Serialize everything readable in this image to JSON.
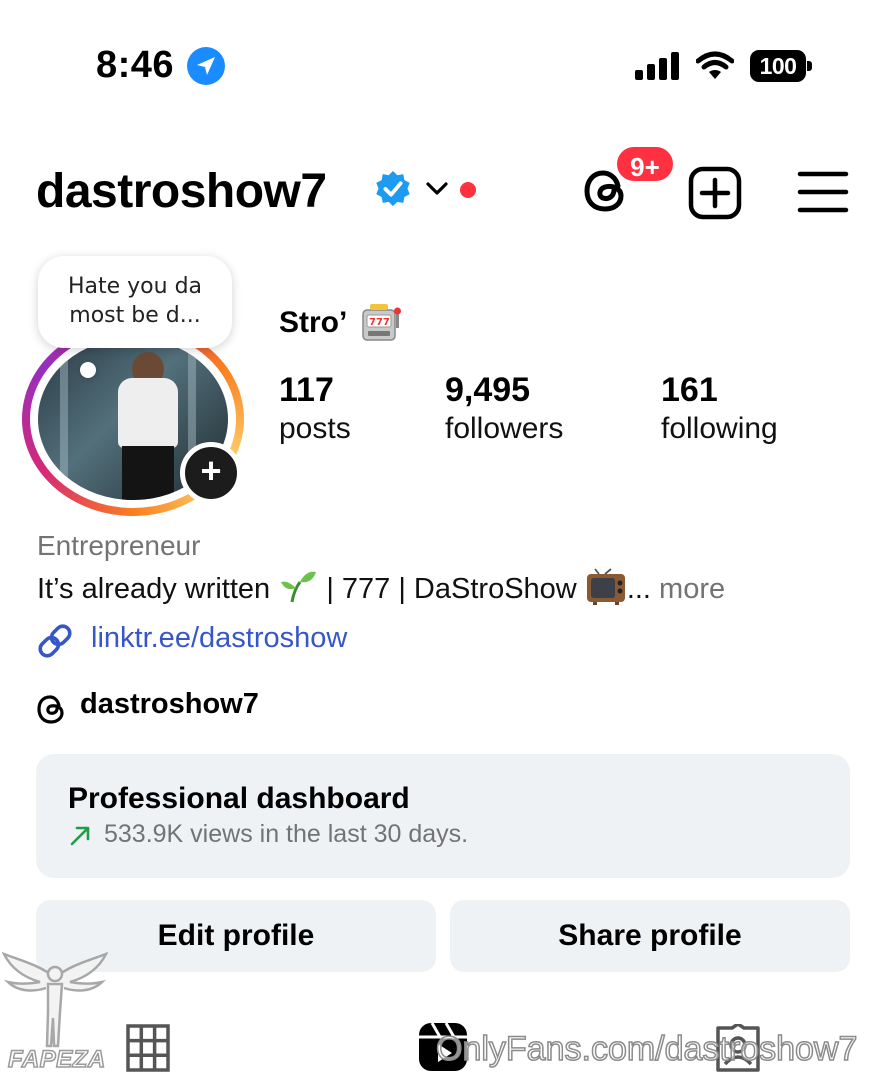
{
  "status_bar": {
    "time": "8:46",
    "battery": "100",
    "icons": [
      "location-arrow-icon",
      "cellular-signal-icon",
      "wifi-icon",
      "battery-icon"
    ]
  },
  "header": {
    "username": "dastroshow7",
    "verified": true,
    "notification_badge": "9+",
    "icons": [
      "verified-badge-icon",
      "chevron-down-icon",
      "threads-icon",
      "create-plus-icon",
      "hamburger-menu-icon"
    ]
  },
  "profile": {
    "note": "Hate you da most be d...",
    "display_name": "Stro’",
    "stats": [
      {
        "value": "117",
        "label": "posts"
      },
      {
        "value": "9,495",
        "label": "followers"
      },
      {
        "value": "161",
        "label": "following"
      }
    ],
    "category": "Entrepreneur",
    "bio_part1": "It’s already written",
    "bio_part2": "| 777 | DaStroShow",
    "bio_ellipsis": "...",
    "bio_more": "more",
    "link": "linktr.ee/dastroshow",
    "threads_handle": "dastroshow7"
  },
  "dashboard": {
    "title": "Professional dashboard",
    "subtitle": "533.9K views in the last 30 days.",
    "accent_color": "#1e9e44"
  },
  "buttons": {
    "edit": "Edit profile",
    "share": "Share profile"
  },
  "tabs": [
    "grid-icon",
    "reels-icon",
    "tagged-icon"
  ],
  "watermarks": {
    "site": "FAPEZA",
    "onlyfans": "OnlyFans.com/dastroshow7"
  },
  "colors": {
    "notification_red": "#ff3040",
    "link_blue": "#3757c9",
    "verified_blue": "#1d9bf0",
    "secondary_text": "#737373",
    "card_bg": "#eff2f5"
  }
}
